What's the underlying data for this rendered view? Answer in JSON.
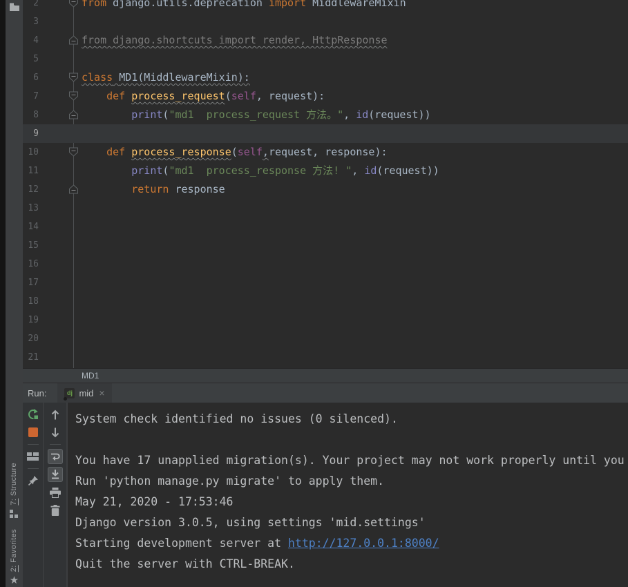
{
  "colors": {
    "editor_bg": "#2b2b2b",
    "caret_row": "#353739",
    "keyword": "#cc7832",
    "string": "#6a8759",
    "builtin": "#8888c6",
    "function_name": "#ffc66d",
    "self_param": "#94558d",
    "default_text": "#a9b7c6",
    "unused_gray": "#7a7a7a",
    "console_link": "#4e82c8",
    "stop_button": "#cd6631",
    "rerun_green": "#5fa469"
  },
  "sidebar": {
    "project_icon": "folder-icon",
    "structure_label": "7: Structure",
    "favorites_label": "2: Favorites",
    "favorites_icon_glyph": "★"
  },
  "editor": {
    "lines": [
      {
        "n": "2",
        "fold": "down",
        "tokens": [
          [
            "from",
            "kw"
          ],
          [
            " django.utils.deprecation ",
            "d"
          ],
          [
            "import",
            "kw"
          ],
          [
            " MiddlewareMixin",
            "d"
          ]
        ]
      },
      {
        "n": "3"
      },
      {
        "n": "4",
        "fold": "up",
        "tokens": [
          [
            "from django.shortcuts import render, HttpResponse",
            "gray",
            "w"
          ]
        ]
      },
      {
        "n": "5"
      },
      {
        "n": "6",
        "fold": "down",
        "tokens": [
          [
            "class",
            "kw",
            "w"
          ],
          [
            " ",
            "d",
            "w"
          ],
          [
            "MD1(MiddlewareMixin):",
            "d",
            "w"
          ]
        ]
      },
      {
        "n": "7",
        "fold": "down",
        "tokens": [
          [
            "    ",
            "d"
          ],
          [
            "def",
            "kw"
          ],
          [
            " ",
            "d"
          ],
          [
            "process_request",
            "fn",
            "w"
          ],
          [
            "(",
            "d"
          ],
          [
            "self",
            "self"
          ],
          [
            ", request):",
            "d"
          ]
        ]
      },
      {
        "n": "8",
        "fold": "up",
        "tokens": [
          [
            "        ",
            "d"
          ],
          [
            "print",
            "bi"
          ],
          [
            "(",
            "d"
          ],
          [
            "\"md1  process_request 方法。\"",
            "str"
          ],
          [
            ", ",
            "d"
          ],
          [
            "id",
            "bi"
          ],
          [
            "(request))",
            "d"
          ]
        ]
      },
      {
        "n": "9",
        "caret": true
      },
      {
        "n": "10",
        "fold": "down",
        "tokens": [
          [
            "    ",
            "d"
          ],
          [
            "def",
            "kw"
          ],
          [
            " ",
            "d"
          ],
          [
            "process_response",
            "fn",
            "w"
          ],
          [
            "(",
            "d"
          ],
          [
            "self",
            "self"
          ],
          [
            ",",
            "d",
            "w"
          ],
          [
            "request, response):",
            "d"
          ]
        ]
      },
      {
        "n": "11",
        "tokens": [
          [
            "        ",
            "d"
          ],
          [
            "print",
            "bi"
          ],
          [
            "(",
            "d"
          ],
          [
            "\"md1  process_response 方法! \"",
            "str"
          ],
          [
            ", ",
            "d"
          ],
          [
            "id",
            "bi"
          ],
          [
            "(request))",
            "d"
          ]
        ]
      },
      {
        "n": "12",
        "fold": "up",
        "tokens": [
          [
            "        ",
            "d"
          ],
          [
            "return",
            "kw"
          ],
          [
            " response",
            "d"
          ]
        ]
      },
      {
        "n": "13"
      },
      {
        "n": "14"
      },
      {
        "n": "15"
      },
      {
        "n": "16"
      },
      {
        "n": "17"
      },
      {
        "n": "18"
      },
      {
        "n": "19"
      },
      {
        "n": "20"
      },
      {
        "n": "21"
      }
    ]
  },
  "breadcrumbs": {
    "items": [
      "MD1"
    ]
  },
  "run": {
    "label": "Run:",
    "tab": {
      "icon_text": "dj",
      "title": "mid",
      "close_glyph": "×"
    },
    "toolbar_left": [
      "rerun",
      "stop",
      "restore-layout",
      "pin"
    ],
    "toolbar_right": [
      "scroll-up",
      "scroll-down",
      "soft-wrap",
      "scroll-to-end",
      "print",
      "clear"
    ]
  },
  "console": {
    "lines": [
      "System check identified no issues (0 silenced).",
      "",
      "You have 17 unapplied migration(s). Your project may not work properly until you",
      "Run 'python manage.py migrate' to apply them.",
      "May 21, 2020 - 17:53:46",
      "Django version 3.0.5, using settings 'mid.settings'",
      {
        "text": "Starting development server at ",
        "link": "http://127.0.0.1:8000/"
      },
      "Quit the server with CTRL-BREAK."
    ]
  }
}
